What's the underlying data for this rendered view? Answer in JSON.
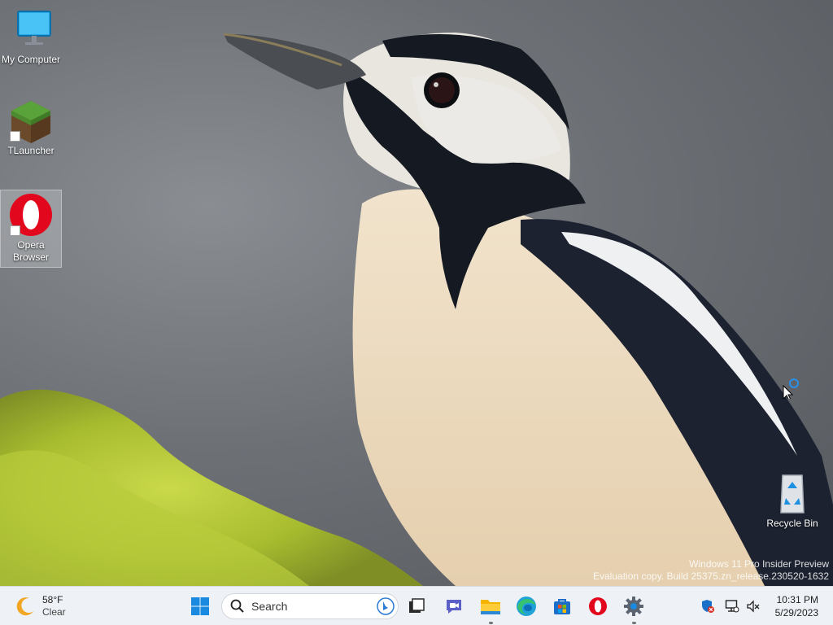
{
  "desktop": {
    "icons": [
      {
        "label": "My Computer"
      },
      {
        "label": "TLauncher"
      },
      {
        "label": "Opera Browser"
      },
      {
        "label": "Recycle Bin"
      }
    ]
  },
  "watermark": {
    "line1": "Windows 11 Pro Insider Preview",
    "line2": "Evaluation copy. Build 25375.zn_release.230520-1632"
  },
  "taskbar": {
    "weather": {
      "temp": "58°F",
      "condition": "Clear",
      "icon": "moon-icon"
    },
    "search": {
      "placeholder": "Search"
    },
    "apps": [
      "start-icon",
      "task-view-icon",
      "teams-chat-icon",
      "file-explorer-icon",
      "edge-icon",
      "store-icon",
      "opera-icon",
      "settings-icon"
    ],
    "tray": [
      "security-icon",
      "network-icon",
      "volume-muted-icon"
    ],
    "clock": {
      "time": "10:31 PM",
      "date": "5/29/2023"
    }
  },
  "colors": {
    "taskbar_bg": "#eef1f6",
    "accent": "#0078d4",
    "opera_red": "#e2071c"
  }
}
